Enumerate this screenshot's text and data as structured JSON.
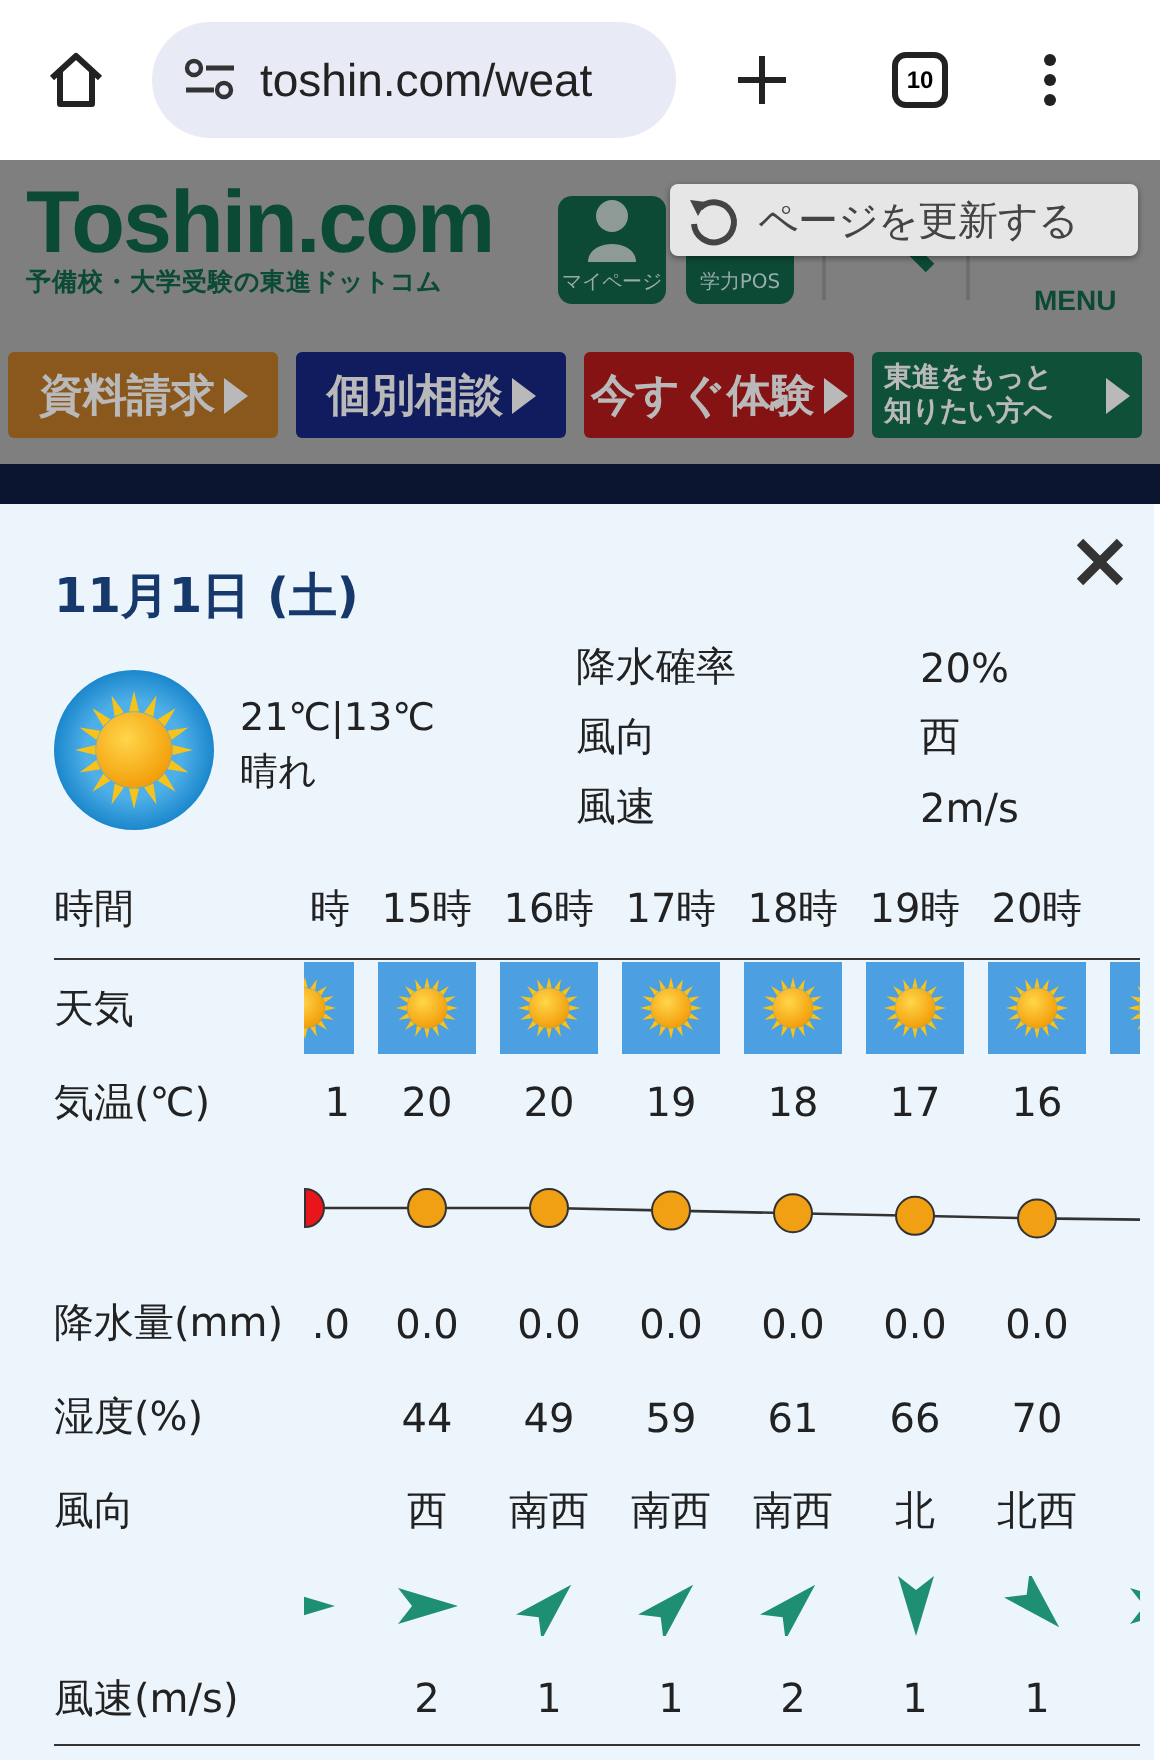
{
  "browser": {
    "url": "toshin.com/weat",
    "tab_count": "10"
  },
  "site": {
    "logo": "Toshin.com",
    "tagline": "予備校・大学受験の東進ドットコム",
    "nav": [
      {
        "kind": "mypage",
        "label": "マイページ"
      },
      {
        "kind": "pos",
        "label": "学力POS"
      },
      {
        "kind": "search"
      },
      {
        "kind": "menu",
        "label": "MENU"
      }
    ],
    "cta": [
      {
        "label": "資料請求",
        "color": "#8a581d"
      },
      {
        "label": "個別相談",
        "color": "#101c5e"
      },
      {
        "label": "今すぐ体験",
        "color": "#861314"
      },
      {
        "label": "東進をもっと知りたい方へ",
        "color": "#0f5039"
      }
    ]
  },
  "toast": {
    "label": "ページを更新する"
  },
  "weather": {
    "date": "11月1日 (土)",
    "icon": {
      "kind": "sunny"
    },
    "temps": "21℃|13℃",
    "condition": "晴れ",
    "details": [
      {
        "label": "降水確率",
        "value": "20%"
      },
      {
        "label": "風向",
        "value": "西"
      },
      {
        "label": "風速",
        "value": "2m/s"
      }
    ],
    "rows": [
      {
        "kind": "hour",
        "label": "時間"
      },
      {
        "kind": "weather",
        "label": "天気"
      },
      {
        "kind": "temp",
        "label": "気温(℃)"
      },
      {
        "kind": "dots"
      },
      {
        "kind": "rain",
        "label": "降水量(mm)"
      },
      {
        "kind": "humidity",
        "label": "湿度(%)"
      },
      {
        "kind": "direction",
        "label": "風向"
      },
      {
        "kind": "arrows"
      },
      {
        "kind": "speed",
        "label": "風速(m/s)"
      }
    ],
    "columns": [
      {
        "kind": "leading",
        "hour": "時",
        "weather": {
          "kind": "sunny"
        },
        "temp": "1",
        "rain": ".0",
        "arrow": {
          "kind": "east"
        },
        "color": "#e8151b"
      },
      {
        "kind": "full",
        "hour": "15時",
        "weather": {
          "kind": "sunny"
        },
        "temp": "20",
        "rain": "0.0",
        "humidity": "44",
        "direction": "西",
        "arrow": {
          "kind": "east"
        },
        "speed": "2",
        "color": "#f0a012"
      },
      {
        "kind": "full",
        "hour": "16時",
        "weather": {
          "kind": "sunny"
        },
        "temp": "20",
        "rain": "0.0",
        "humidity": "49",
        "direction": "南西",
        "arrow": {
          "kind": "northeast"
        },
        "speed": "1",
        "color": "#f0a012"
      },
      {
        "kind": "full",
        "hour": "17時",
        "weather": {
          "kind": "sunny"
        },
        "temp": "19",
        "rain": "0.0",
        "humidity": "59",
        "direction": "南西",
        "arrow": {
          "kind": "northeast"
        },
        "speed": "1",
        "color": "#f0a012"
      },
      {
        "kind": "full",
        "hour": "18時",
        "weather": {
          "kind": "sunny"
        },
        "temp": "18",
        "rain": "0.0",
        "humidity": "61",
        "direction": "南西",
        "arrow": {
          "kind": "northeast"
        },
        "speed": "2",
        "color": "#f0a012"
      },
      {
        "kind": "full",
        "hour": "19時",
        "weather": {
          "kind": "sunny"
        },
        "temp": "17",
        "rain": "0.0",
        "humidity": "66",
        "direction": "北",
        "arrow": {
          "kind": "south"
        },
        "speed": "1",
        "color": "#f0a012"
      },
      {
        "kind": "full",
        "hour": "20時",
        "weather": {
          "kind": "sunny"
        },
        "temp": "16",
        "rain": "0.0",
        "humidity": "70",
        "direction": "北西",
        "arrow": {
          "kind": "southeast"
        },
        "speed": "1",
        "color": "#f0a012"
      },
      {
        "kind": "trailing",
        "weather": {
          "kind": "sunny"
        },
        "arrow": {
          "kind": "east"
        }
      }
    ]
  }
}
